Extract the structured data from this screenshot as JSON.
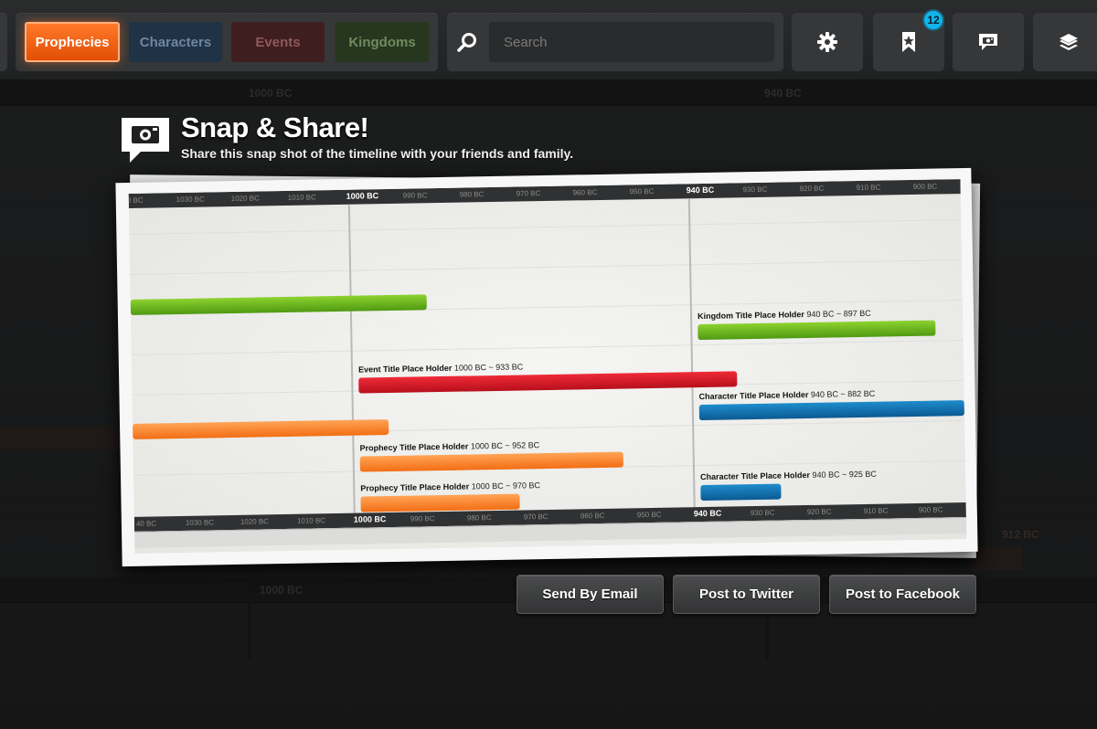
{
  "nav": {
    "tabs": [
      {
        "label": "Prophecies",
        "active": true,
        "color": "#f05c10"
      },
      {
        "label": "Characters",
        "active": false,
        "color": "#1f3246"
      },
      {
        "label": "Events",
        "active": false,
        "color": "#3f1e1f"
      },
      {
        "label": "Kingdoms",
        "active": false,
        "color": "#27361f"
      }
    ],
    "search": {
      "placeholder": "Search",
      "icon": "search-icon"
    },
    "icons": {
      "settings": "gear-icon",
      "bookmarks": "bookmark-star-icon",
      "snap": "camera-chat-icon",
      "layers": "layers-icon"
    },
    "bookmark_badge": "12"
  },
  "background": {
    "ruler_top": [
      "1000 BC",
      "940 BC"
    ],
    "ruler_bottom": [
      "1000 BC",
      "912 BC"
    ]
  },
  "overlay": {
    "title": "Snap & Share!",
    "subtitle": "Share this snap shot of the timeline with your friends and family.",
    "icon": "camera-chat-icon"
  },
  "snapshot": {
    "ruler_top": [
      "0 BC",
      "1030 BC",
      "1020 BC",
      "1010 BC",
      "1000 BC",
      "990 BC",
      "980 BC",
      "970 BC",
      "960 BC",
      "950 BC",
      "940 BC",
      "930 BC",
      "920 BC",
      "910 BC",
      "900 BC"
    ],
    "ruler_bottom": [
      "40 BC",
      "1030 BC",
      "1020 BC",
      "1010 BC",
      "1000 BC",
      "990 BC",
      "980 BC",
      "970 BC",
      "960 BC",
      "950 BC",
      "940 BC",
      "930 BC",
      "920 BC",
      "910 BC",
      "900 BC"
    ],
    "items": [
      {
        "title": "Kingdom Title Place Holder",
        "range": "940 BC ~ 897 BC",
        "color": "#5eaa18"
      },
      {
        "title": "Event Title Place Holder",
        "range": "1000 BC ~ 933 BC",
        "color": "#d0172a"
      },
      {
        "title": "Character Title Place Holder",
        "range": "940 BC ~ 882 BC",
        "color": "#1172b3"
      },
      {
        "title": "Prophecy Title Place Holder",
        "range": "1000 BC ~ 952 BC",
        "color": "#f7841f"
      },
      {
        "title": "Character Title Place Holder",
        "range": "940 BC ~ 925 BC",
        "color": "#1172b3"
      },
      {
        "title": "Prophecy Title Place Holder",
        "range": "1000 BC ~ 970 BC",
        "color": "#f7841f"
      }
    ]
  },
  "actions": {
    "email": "Send By Email",
    "twitter": "Post to Twitter",
    "facebook": "Post to Facebook"
  }
}
